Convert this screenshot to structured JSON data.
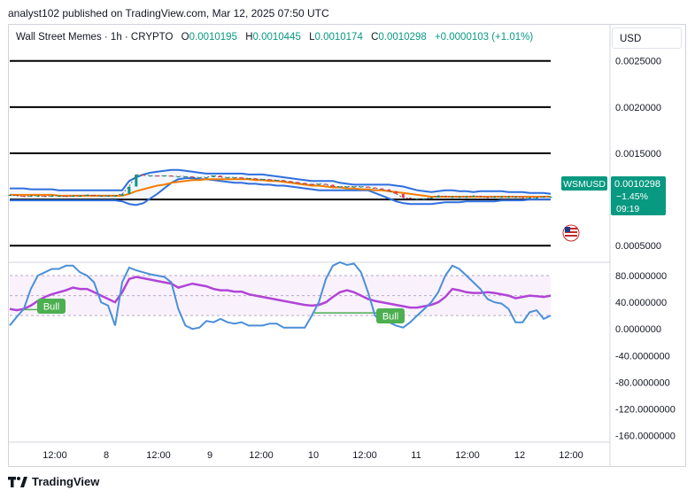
{
  "header": {
    "text": "analyst102 published on TradingView.com, Mar 12, 2025 07:50 UTC"
  },
  "symbol": {
    "name": "Wall Street Memes · 1h · CRYPTO",
    "open_label": "O",
    "open": "0.0010195",
    "high_label": "H",
    "high": "0.0010445",
    "low_label": "L",
    "low": "0.0010174",
    "close_label": "C",
    "close": "0.0010298",
    "change": "+0.0000103 (+1.01%)"
  },
  "currency_button": "USD",
  "price_tag": {
    "ticker": "WSMUSD",
    "price": "0.0010298",
    "change": "−1.45%",
    "countdown": "09:19"
  },
  "badges": [
    "Bull",
    "Bull"
  ],
  "footer": {
    "brand": "TradingView"
  },
  "colors": {
    "bollinger": "#2f6fdd",
    "ema": "#f57c00",
    "stoch_k": "#4a8fd8",
    "stoch_d": "#b144d6",
    "bull_badge": "#4caf50",
    "price_tag": "#089981",
    "positive": "#089981"
  },
  "chart_data": [
    {
      "type": "line",
      "panel": "price",
      "y_axis_labels": [
        "0.0025000",
        "0.0020000",
        "0.0015000",
        "0.0005000"
      ],
      "ylim": [
        0.00032,
        0.0029
      ],
      "x_labels": [
        "12:00",
        "8",
        "12:00",
        "9",
        "12:00",
        "10",
        "12:00",
        "11",
        "12:00",
        "12",
        "12:00"
      ],
      "horizontal_levels": [
        0.0025,
        0.002,
        0.0015,
        0.001,
        0.0005
      ],
      "x": [
        0,
        8,
        16,
        24,
        32,
        40,
        48,
        56,
        64,
        72,
        80,
        88,
        96,
        104,
        112,
        120,
        128,
        136,
        144,
        152,
        160,
        168,
        176,
        184,
        192,
        200,
        208,
        216,
        224,
        232,
        240,
        248,
        256,
        264,
        272,
        280,
        288,
        296,
        304,
        312,
        320,
        328,
        336,
        344,
        352,
        360,
        368,
        376,
        384,
        392,
        400,
        408,
        416,
        424,
        432,
        440,
        448,
        456,
        464,
        472,
        480,
        488,
        496,
        504,
        512,
        520,
        528,
        536,
        544,
        552,
        560,
        568,
        576,
        584,
        592,
        600,
        608,
        616
      ],
      "series": [
        {
          "role": "price",
          "values": [
            0.00105,
            0.00104,
            0.00103,
            0.00104,
            0.00104,
            0.00103,
            0.00104,
            0.00104,
            0.00103,
            0.00104,
            0.00104,
            0.00105,
            0.00104,
            0.00104,
            0.00104,
            0.00104,
            0.00106,
            0.00114,
            0.00127,
            0.00126,
            0.00126,
            0.00125,
            0.00126,
            0.00125,
            0.00125,
            0.00125,
            0.00124,
            0.00124,
            0.00124,
            0.00126,
            0.00124,
            0.00124,
            0.00124,
            0.00123,
            0.00123,
            0.00122,
            0.00122,
            0.00121,
            0.00121,
            0.0012,
            0.00119,
            0.00118,
            0.00117,
            0.00116,
            0.00117,
            0.00116,
            0.00114,
            0.00114,
            0.00114,
            0.00114,
            0.00114,
            0.00113,
            0.00112,
            0.00111,
            0.00109,
            0.00106,
            0.00102,
            0.00101,
            0.00101,
            0.00101,
            0.00102,
            0.00104,
            0.00103,
            0.00103,
            0.00103,
            0.00103,
            0.00104,
            0.00103,
            0.00102,
            0.00103,
            0.00103,
            0.00103,
            0.00103,
            0.00102,
            0.00102,
            0.00102,
            0.00103,
            0.00103
          ]
        },
        {
          "role": "bollinger-upper",
          "values": [
            0.00112,
            0.00112,
            0.00112,
            0.00111,
            0.00111,
            0.00111,
            0.00111,
            0.0011,
            0.0011,
            0.0011,
            0.0011,
            0.0011,
            0.0011,
            0.0011,
            0.0011,
            0.0011,
            0.0011,
            0.0012,
            0.00124,
            0.00127,
            0.00129,
            0.0013,
            0.00131,
            0.00132,
            0.00132,
            0.00131,
            0.0013,
            0.00129,
            0.00128,
            0.00128,
            0.00128,
            0.00128,
            0.00128,
            0.00128,
            0.00127,
            0.00127,
            0.00127,
            0.00126,
            0.00125,
            0.00124,
            0.00123,
            0.00122,
            0.00121,
            0.0012,
            0.0012,
            0.0012,
            0.0012,
            0.00118,
            0.00117,
            0.00116,
            0.00116,
            0.00116,
            0.00116,
            0.00116,
            0.00116,
            0.00115,
            0.00114,
            0.00112,
            0.0011,
            0.00109,
            0.00108,
            0.00109,
            0.0011,
            0.0011,
            0.00109,
            0.00109,
            0.00108,
            0.00109,
            0.00109,
            0.00109,
            0.00109,
            0.00108,
            0.00108,
            0.00108,
            0.00107,
            0.00107,
            0.00107,
            0.00106
          ]
        },
        {
          "role": "bollinger-lower",
          "values": [
            0.00099,
            0.00099,
            0.00099,
            0.00099,
            0.00099,
            0.00099,
            0.00099,
            0.00099,
            0.00099,
            0.00099,
            0.00099,
            0.00099,
            0.00099,
            0.00099,
            0.00099,
            0.00099,
            0.00098,
            0.00095,
            0.00094,
            0.00096,
            0.00101,
            0.00106,
            0.00112,
            0.00118,
            0.00122,
            0.00123,
            0.00123,
            0.00122,
            0.00122,
            0.00121,
            0.0012,
            0.00119,
            0.00118,
            0.00118,
            0.00117,
            0.00117,
            0.00116,
            0.00116,
            0.00115,
            0.00115,
            0.00114,
            0.00113,
            0.00112,
            0.00111,
            0.0011,
            0.0011,
            0.0011,
            0.0011,
            0.0011,
            0.0011,
            0.0011,
            0.0011,
            0.00107,
            0.00104,
            0.00101,
            0.00098,
            0.00096,
            0.00095,
            0.00095,
            0.00095,
            0.00095,
            0.00096,
            0.00097,
            0.00097,
            0.00097,
            0.00098,
            0.00098,
            0.00098,
            0.00098,
            0.00098,
            0.00099,
            0.00099,
            0.00099,
            0.00099,
            0.001,
            0.001,
            0.001,
            0.001
          ]
        },
        {
          "role": "ema",
          "values": [
            0.00105,
            0.00105,
            0.00105,
            0.00105,
            0.00105,
            0.00105,
            0.00105,
            0.00104,
            0.00104,
            0.00104,
            0.00104,
            0.00104,
            0.00104,
            0.00104,
            0.00104,
            0.00104,
            0.00104,
            0.00106,
            0.00109,
            0.00111,
            0.00113,
            0.00115,
            0.00116,
            0.00118,
            0.00119,
            0.0012,
            0.00121,
            0.00121,
            0.00122,
            0.00122,
            0.00122,
            0.00122,
            0.00122,
            0.00122,
            0.00122,
            0.00121,
            0.00121,
            0.0012,
            0.0012,
            0.00119,
            0.00118,
            0.00117,
            0.00116,
            0.00115,
            0.00115,
            0.00114,
            0.00113,
            0.00113,
            0.00112,
            0.00112,
            0.00111,
            0.00111,
            0.0011,
            0.0011,
            0.00109,
            0.00108,
            0.00107,
            0.00106,
            0.00105,
            0.00104,
            0.00103,
            0.00103,
            0.00103,
            0.00103,
            0.00103,
            0.00103,
            0.00103,
            0.00103,
            0.00103,
            0.00103,
            0.00103,
            0.00103,
            0.00103,
            0.00103,
            0.00103,
            0.00103,
            0.00103,
            0.00103
          ]
        }
      ]
    },
    {
      "type": "line",
      "panel": "oscillator",
      "y_axis_labels": [
        "80.0000000",
        "40.0000000",
        "0.0000000",
        "-40.0000000",
        "-80.0000000",
        "-120.0000000",
        "-160.0000000"
      ],
      "ylim": [
        -170,
        100
      ],
      "band": [
        20,
        80
      ],
      "midline": 50,
      "x": [
        0,
        8,
        16,
        24,
        32,
        40,
        48,
        56,
        64,
        72,
        80,
        88,
        96,
        104,
        112,
        120,
        128,
        136,
        144,
        152,
        160,
        168,
        176,
        184,
        192,
        200,
        208,
        216,
        224,
        232,
        240,
        248,
        256,
        264,
        272,
        280,
        288,
        296,
        304,
        312,
        320,
        328,
        336,
        344,
        352,
        360,
        368,
        376,
        384,
        392,
        400,
        408,
        416,
        424,
        432,
        440,
        448,
        456,
        464,
        472,
        480,
        488,
        496,
        504,
        512,
        520,
        528,
        536,
        544,
        552,
        560,
        568,
        576,
        584,
        592,
        600,
        608,
        616
      ],
      "series": [
        {
          "role": "stoch-k",
          "values": [
            5,
            18,
            30,
            60,
            80,
            85,
            90,
            90,
            95,
            95,
            85,
            80,
            70,
            40,
            35,
            5,
            70,
            92,
            88,
            85,
            82,
            80,
            78,
            70,
            30,
            5,
            0,
            2,
            12,
            10,
            15,
            10,
            8,
            10,
            5,
            5,
            5,
            8,
            8,
            2,
            2,
            2,
            2,
            20,
            40,
            75,
            95,
            100,
            96,
            98,
            85,
            55,
            20,
            10,
            10,
            5,
            2,
            10,
            20,
            30,
            40,
            55,
            80,
            95,
            90,
            80,
            70,
            60,
            45,
            40,
            38,
            30,
            10,
            10,
            25,
            28,
            15,
            20
          ]
        },
        {
          "role": "stoch-d",
          "values": [
            30,
            28,
            30,
            35,
            42,
            48,
            52,
            55,
            58,
            62,
            60,
            60,
            55,
            50,
            45,
            40,
            55,
            75,
            78,
            76,
            74,
            72,
            70,
            68,
            62,
            65,
            68,
            66,
            64,
            60,
            58,
            58,
            56,
            56,
            52,
            50,
            48,
            46,
            44,
            42,
            40,
            38,
            36,
            35,
            36,
            40,
            48,
            55,
            58,
            55,
            50,
            45,
            42,
            40,
            38,
            36,
            34,
            32,
            32,
            34,
            36,
            40,
            48,
            60,
            58,
            55,
            54,
            54,
            55,
            54,
            52,
            50,
            46,
            48,
            50,
            49,
            48,
            50
          ]
        }
      ]
    }
  ]
}
